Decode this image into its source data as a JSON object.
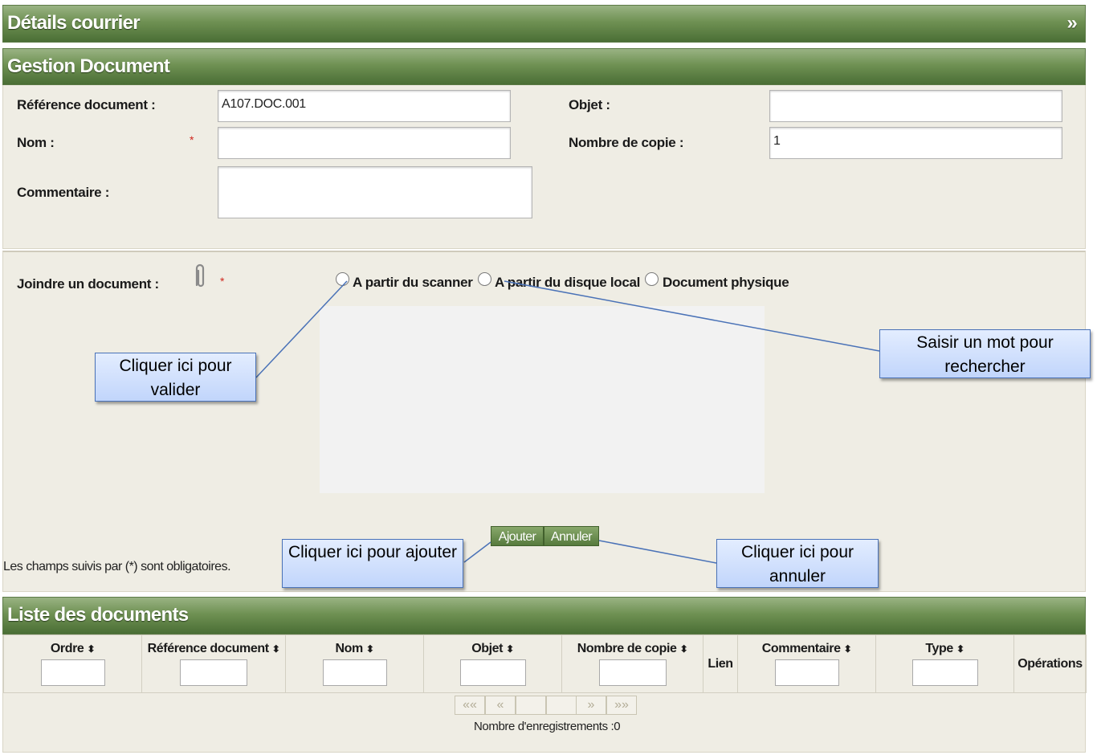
{
  "sections": {
    "details_title": "Détails courrier",
    "details_expand": "»",
    "gestion_title": "Gestion Document",
    "liste_title": "Liste des documents"
  },
  "form": {
    "reference_label": "Référence document :",
    "reference_value": "A107.DOC.001",
    "nom_label": "Nom :",
    "nom_value": "",
    "commentaire_label": "Commentaire :",
    "commentaire_value": "",
    "objet_label": "Objet :",
    "objet_value": "",
    "copies_label": "Nombre de copie :",
    "copies_value": "1",
    "required_mark": "*",
    "joindre_label": "Joindre un document :",
    "options": [
      "A partir du scanner",
      "A partir du disque local",
      "Document physique"
    ],
    "selected_option": "",
    "ajouter_label": "Ajouter",
    "annuler_label": "Annuler",
    "required_note": "Les champs suivis par (*) sont obligatoires."
  },
  "callouts": {
    "valider": "Cliquer ici pour valider",
    "rechercher": "Saisir un mot pour rechercher",
    "ajouter": "Cliquer ici pour ajouter",
    "annuler": "Cliquer ici pour annuler"
  },
  "table": {
    "columns": [
      {
        "label": "Ordre",
        "sortable": true,
        "filter": true
      },
      {
        "label": "Référence document",
        "sortable": true,
        "filter": true
      },
      {
        "label": "Nom",
        "sortable": true,
        "filter": true
      },
      {
        "label": "Objet",
        "sortable": true,
        "filter": true
      },
      {
        "label": "Nombre de copie",
        "sortable": true,
        "filter": true
      },
      {
        "label": "Lien",
        "sortable": false,
        "filter": false
      },
      {
        "label": "Commentaire",
        "sortable": true,
        "filter": true
      },
      {
        "label": "Type",
        "sortable": true,
        "filter": true
      },
      {
        "label": "Opérations",
        "sortable": false,
        "filter": false
      }
    ],
    "sort_glyph": "⬍",
    "rows": [],
    "pager": {
      "first": "««",
      "prev": "«",
      "next": "»",
      "last": "»»"
    },
    "record_count": "Nombre d'enregistrements :0"
  },
  "icons": [
    "paperclip-icon"
  ],
  "colors": {
    "header_green": "#5d7f42",
    "panel_bg": "#efede4",
    "callout_border": "#4a72b7",
    "required_red": "#d0261d"
  }
}
